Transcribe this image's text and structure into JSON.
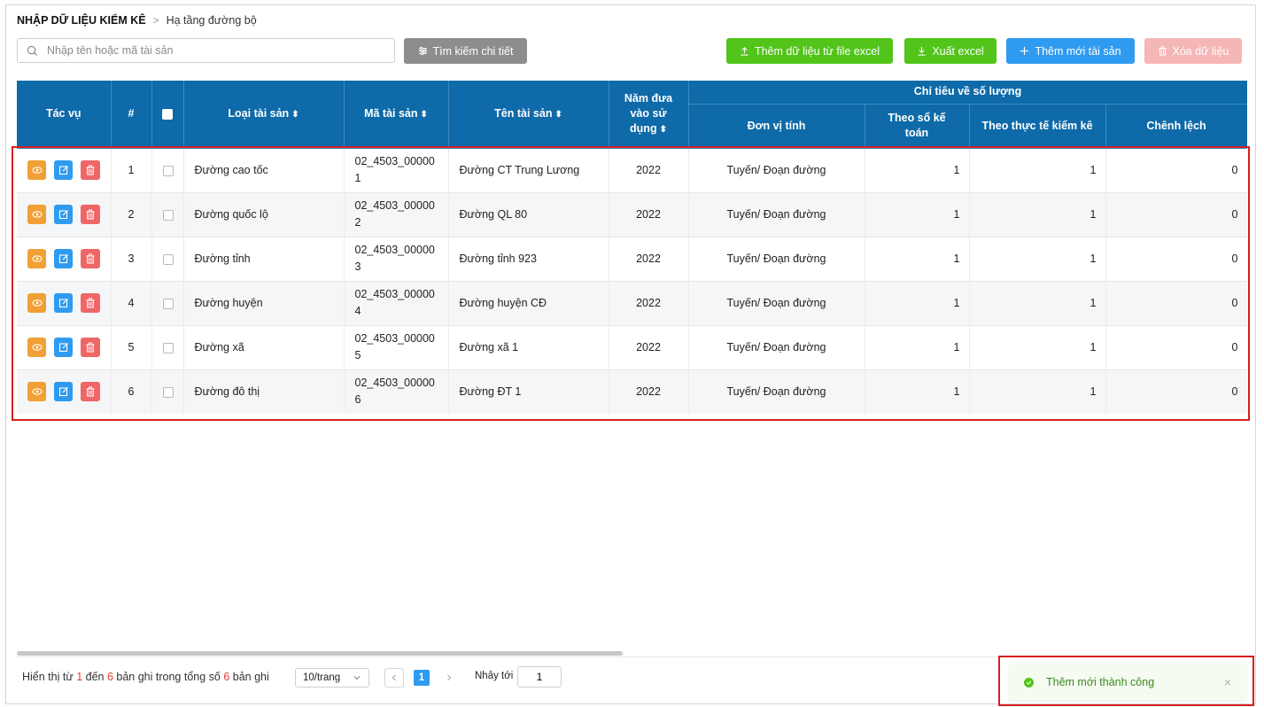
{
  "breadcrumb": {
    "root": "NHẬP DỮ LIỆU KIỂM KÊ",
    "separator": ">",
    "current": "Hạ tầng đường bộ"
  },
  "search": {
    "placeholder": "Nhập tên hoặc mã tài sản",
    "value": ""
  },
  "toolbar": {
    "detail_search": "Tìm kiếm chi tiết",
    "import_excel": "Thêm dữ liệu từ file excel",
    "export_excel": "Xuất excel",
    "add_asset": "Thêm mới tài sản",
    "delete_data": "Xóa dữ liệu"
  },
  "table": {
    "headers": {
      "actions": "Tác vụ",
      "index": "#",
      "type": "Loại tài sản",
      "code": "Mã tài sản",
      "name": "Tên tài sản",
      "year_line1": "Năm đưa",
      "year_line2": "vào sử",
      "year_line3": "dụng",
      "group": "Chỉ tiêu về số lượng",
      "unit": "Đơn vị tính",
      "book_line1": "Theo sổ kế",
      "book_line2": "toán",
      "actual": "Theo thực tế kiểm kê",
      "diff": "Chênh lệch"
    },
    "rows": [
      {
        "index": "1",
        "type": "Đường cao tốc",
        "code": "02_4503_000001",
        "name": "Đường CT Trung Lương",
        "year": "2022",
        "unit": "Tuyến/ Đoạn đường",
        "book": "1",
        "actual": "1",
        "diff": "0"
      },
      {
        "index": "2",
        "type": "Đường quốc lộ",
        "code": "02_4503_000002",
        "name": "Đường QL 80",
        "year": "2022",
        "unit": "Tuyến/ Đoạn đường",
        "book": "1",
        "actual": "1",
        "diff": "0"
      },
      {
        "index": "3",
        "type": "Đường tỉnh",
        "code": "02_4503_000003",
        "name": "Đường tỉnh 923",
        "year": "2022",
        "unit": "Tuyến/ Đoạn đường",
        "book": "1",
        "actual": "1",
        "diff": "0"
      },
      {
        "index": "4",
        "type": "Đường huyện",
        "code": "02_4503_000004",
        "name": "Đường huyện CĐ",
        "year": "2022",
        "unit": "Tuyến/ Đoạn đường",
        "book": "1",
        "actual": "1",
        "diff": "0"
      },
      {
        "index": "5",
        "type": "Đường xã",
        "code": "02_4503_000005",
        "name": "Đường xã 1",
        "year": "2022",
        "unit": "Tuyến/ Đoạn đường",
        "book": "1",
        "actual": "1",
        "diff": "0"
      },
      {
        "index": "6",
        "type": "Đường đô thị",
        "code": "02_4503_000006",
        "name": "Đường ĐT 1",
        "year": "2022",
        "unit": "Tuyến/ Đoạn đường",
        "book": "1",
        "actual": "1",
        "diff": "0"
      }
    ]
  },
  "pagination": {
    "text_showing": "Hiển thị từ",
    "from": "1",
    "text_to": "đến",
    "to": "6",
    "text_of": "bản ghi trong tổng số",
    "total": "6",
    "text_records": "bản ghi",
    "page_size": "10/trang",
    "current_page": "1",
    "jump_label": "Nhảy tới",
    "jump_value": "1"
  },
  "toast": {
    "message": "Thêm mới thành công",
    "close": "×"
  },
  "colors": {
    "header_bg": "#0e6aa8",
    "green": "#52c41a",
    "blue": "#2f9bf0",
    "orange": "#f0a034",
    "red": "#ef6666",
    "highlight": "#d61f1f"
  },
  "icons": [
    "search-icon",
    "filter-icon",
    "upload-icon",
    "download-icon",
    "plus-icon",
    "trash-icon",
    "eye-icon",
    "edit-icon",
    "check-circle-icon",
    "chevron-down-icon",
    "chevron-left-icon",
    "chevron-right-icon",
    "close-icon"
  ]
}
